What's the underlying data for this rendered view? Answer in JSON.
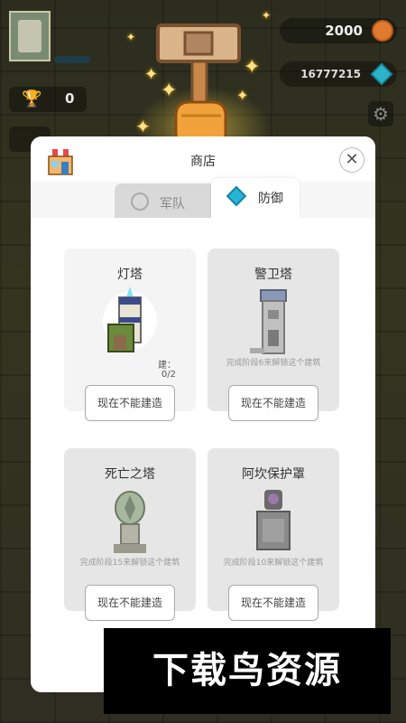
{
  "hud": {
    "trophies": "0",
    "coins": "2000",
    "gems": "16777215"
  },
  "dialog": {
    "title": "商店",
    "tabs": [
      {
        "label": "军队",
        "active": false
      },
      {
        "label": "防御",
        "active": true
      }
    ],
    "cards": [
      {
        "name": "灯塔",
        "note": "",
        "count_label": "建：",
        "count": "0/2",
        "button": "现在不能建造",
        "locked": false
      },
      {
        "name": "警卫塔",
        "note": "完成阶段6来解锁这个建筑",
        "button": "现在不能建造",
        "locked": true
      },
      {
        "name": "死亡之塔",
        "note": "完成阶段15来解锁这个建筑",
        "button": "现在不能建造",
        "locked": true
      },
      {
        "name": "阿坎保护罩",
        "note": "完成阶段10来解锁这个建筑",
        "button": "现在不能建造",
        "locked": true
      }
    ]
  },
  "watermark": "下载鸟资源",
  "colors": {
    "accent_cyan": "#2ab4d8",
    "coin_orange": "#e07a2f",
    "panel": "#f7f7f7"
  }
}
